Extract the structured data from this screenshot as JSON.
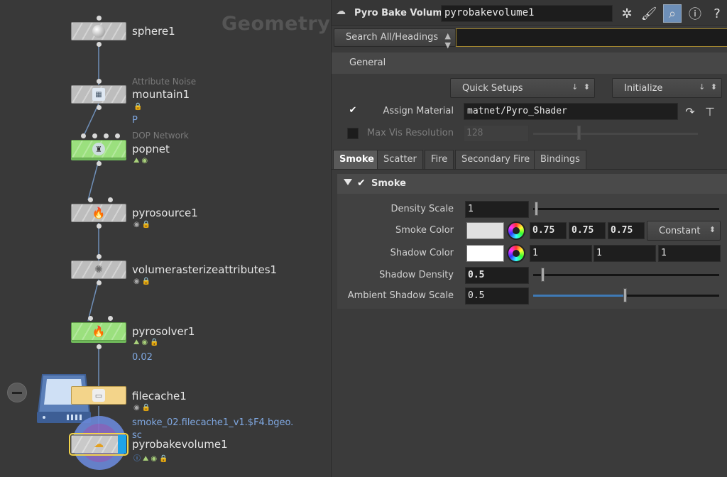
{
  "network": {
    "title": "Geometry",
    "nodes": [
      {
        "name": "sphere1",
        "subtitle": "",
        "info": ""
      },
      {
        "name": "mountain1",
        "subtitle": "Attribute Noise",
        "info": "P"
      },
      {
        "name": "popnet",
        "subtitle": "DOP Network",
        "info": ""
      },
      {
        "name": "pyrosource1",
        "subtitle": "",
        "info": ""
      },
      {
        "name": "volumerasterizeattributes1",
        "subtitle": "",
        "info": ""
      },
      {
        "name": "pyrosolver1",
        "subtitle": "",
        "info": "0.02"
      },
      {
        "name": "filecache1",
        "subtitle": "",
        "info": "smoke_02.filecache1_v1.$F4.bgeo.",
        "info2": "sc"
      },
      {
        "name": "pyrobakevolume1",
        "subtitle": "",
        "info": ""
      }
    ],
    "colors": {
      "green_node": "#9be07e",
      "yellow_node": "#f3d48a",
      "selected": "#f2d44a"
    }
  },
  "params": {
    "node_type": "Pyro Bake Volume",
    "node_name": "pyrobakevolume1",
    "toolbar_icons": [
      "gear-icon",
      "brush-icon",
      "search-icon",
      "info-icon",
      "help-icon"
    ],
    "search": {
      "mode": "Search All/Headings",
      "value": ""
    },
    "general_tab": "General",
    "quick_setups": "Quick Setups",
    "initialize": "Initialize",
    "assign_material": {
      "label": "Assign Material",
      "checked": true,
      "value": "matnet/Pyro_Shader"
    },
    "max_vis_resolution": {
      "label": "Max Vis Resolution",
      "checked": false,
      "value": "128"
    },
    "tabs": [
      "Smoke",
      "Scatter",
      "Fire",
      "Secondary Fire",
      "Bindings"
    ],
    "active_tab": "Smoke",
    "smoke": {
      "folder_label": "Smoke",
      "density_scale": {
        "label": "Density Scale",
        "value": "1",
        "slider": 0.01
      },
      "smoke_color": {
        "label": "Smoke Color",
        "r": "0.75",
        "g": "0.75",
        "b": "0.75",
        "mode": "Constant",
        "swatch": "#e0e0e0"
      },
      "shadow_color": {
        "label": "Shadow Color",
        "r": "1",
        "g": "1",
        "b": "1",
        "swatch": "#ffffff"
      },
      "shadow_density": {
        "label": "Shadow Density",
        "value": "0.5",
        "slider": 0.05
      },
      "ambient_shadow_scale": {
        "label": "Ambient Shadow Scale",
        "value": "0.5",
        "slider": 0.5
      }
    }
  }
}
